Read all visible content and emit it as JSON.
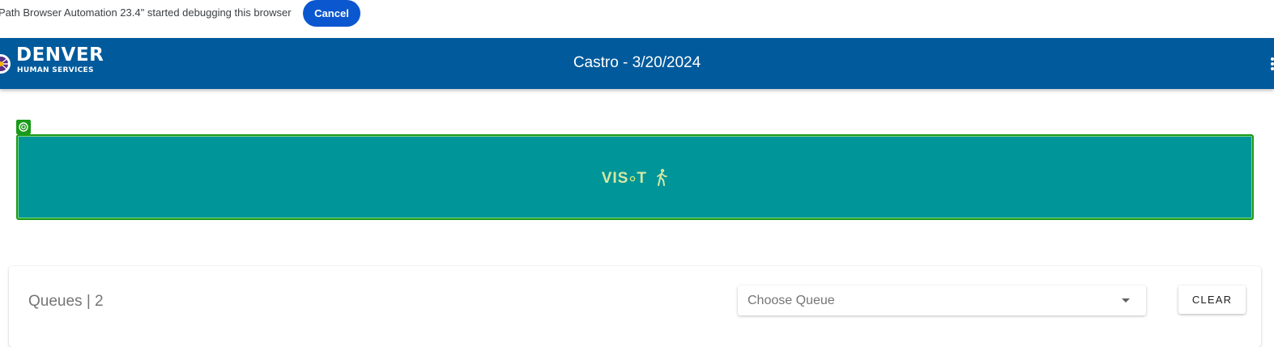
{
  "infobar": {
    "message": "Path Browser Automation 23.4\" started debugging this browser",
    "cancel_label": "Cancel",
    "accent": "#0b57d0"
  },
  "header": {
    "logo_title": "DENVER",
    "logo_subtitle": "HUMAN SERVICES",
    "title": "Castro - 3/20/2024",
    "background": "#005a9c",
    "menu_icon": "more-vert-icon"
  },
  "visit": {
    "label_prefix": "VIS",
    "label_suffix": "T",
    "icon": "walking-person-icon",
    "marker_icon": "target-icon",
    "background": "#009598",
    "border": "#1a9a1a"
  },
  "queues": {
    "title": "Queues | 2",
    "select_placeholder": "Choose Queue",
    "clear_label": "CLEAR"
  }
}
